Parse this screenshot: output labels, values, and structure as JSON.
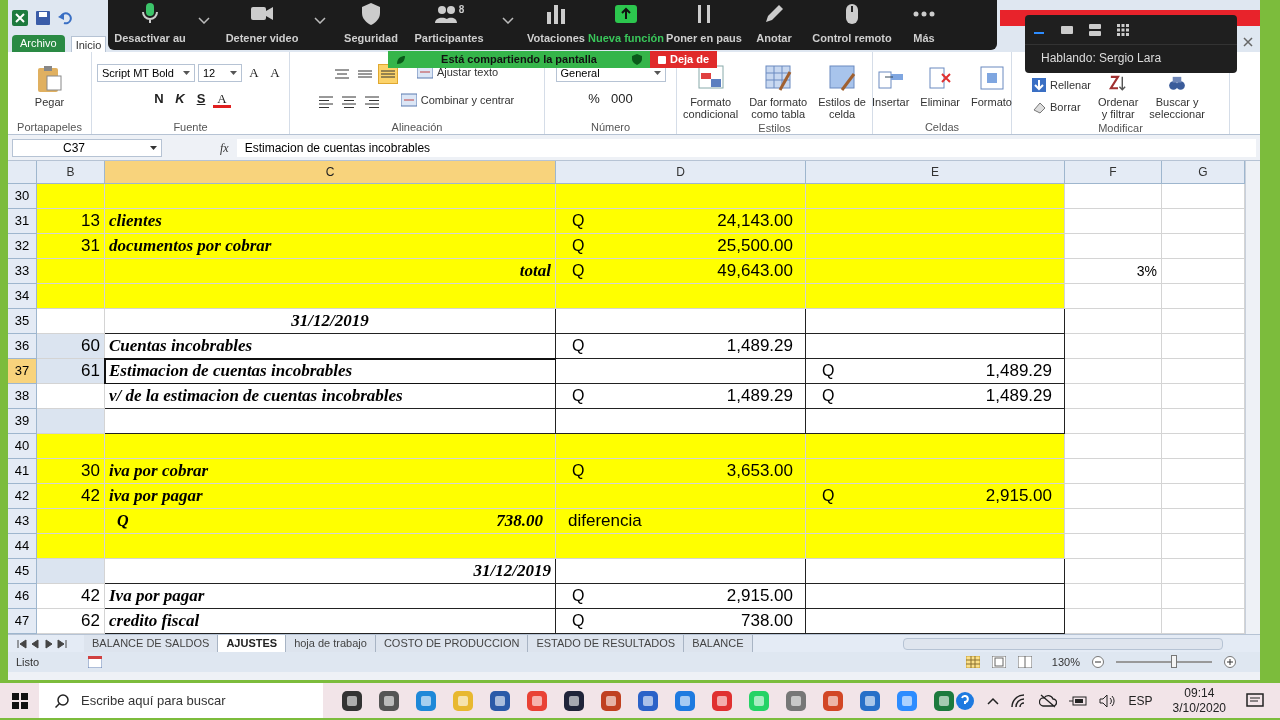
{
  "excel": {
    "ribbon_tabs": [
      {
        "label": "Archivo",
        "kind": "file",
        "selected": false
      },
      {
        "label": "Inicio",
        "kind": "tab",
        "selected": true
      }
    ],
    "ribbon_groups": [
      {
        "label": "Portapapeles",
        "rows": [
          [
            {
              "kind": "large",
              "lines": [
                "Pegar"
              ]
            }
          ]
        ]
      },
      {
        "label": "Fuente",
        "rows": [
          [
            {
              "kind": "field",
              "value": "Script MT Bold"
            },
            {
              "kind": "field",
              "value": "12"
            },
            {
              "kind": "glyph",
              "text": "A"
            },
            {
              "kind": "glyph",
              "text": "A"
            }
          ],
          [
            {
              "kind": "glyph",
              "text": "N"
            },
            {
              "kind": "glyph",
              "text": "K"
            },
            {
              "kind": "glyph",
              "text": "S"
            },
            {
              "kind": "glyph",
              "text": "A"
            }
          ]
        ]
      },
      {
        "label": "Alineación",
        "rows": [
          [
            {
              "kind": "align",
              "selected": false
            },
            {
              "kind": "align",
              "selected": false
            },
            {
              "kind": "align",
              "selected": true
            },
            {
              "kind": "small",
              "label": "Ajustar texto"
            }
          ],
          [
            {
              "kind": "align",
              "selected": false
            },
            {
              "kind": "align",
              "selected": false
            },
            {
              "kind": "align",
              "selected": false
            },
            {
              "kind": "small",
              "label": "Combinar y centrar"
            }
          ]
        ]
      },
      {
        "label": "Número",
        "rows": [
          [
            {
              "kind": "field",
              "value": "General"
            }
          ],
          [
            {
              "kind": "glyph",
              "text": "%"
            },
            {
              "kind": "glyph",
              "text": "000"
            }
          ]
        ]
      },
      {
        "label": "Estilos",
        "rows": [
          [
            {
              "kind": "large",
              "lines": [
                "Formato",
                "condicional"
              ]
            },
            {
              "kind": "large",
              "lines": [
                "Dar formato",
                "como tabla"
              ]
            },
            {
              "kind": "large",
              "lines": [
                "Estilos de",
                "celda"
              ]
            }
          ]
        ]
      },
      {
        "label": "Celdas",
        "rows": [
          [
            {
              "kind": "large",
              "lines": [
                "Insertar"
              ]
            },
            {
              "kind": "large",
              "lines": [
                "Eliminar"
              ]
            },
            {
              "kind": "large",
              "lines": [
                "Formato"
              ]
            }
          ]
        ]
      },
      {
        "label": "Modificar",
        "rows": [
          [
            {
              "kind": "stack",
              "items": [
                {
                  "label": "Rellenar"
                },
                {
                  "label": "Borrar"
                }
              ]
            },
            {
              "kind": "large",
              "lines": [
                "Ordenar",
                "y filtrar"
              ]
            },
            {
              "kind": "large",
              "lines": [
                "Buscar y",
                "seleccionar"
              ]
            }
          ]
        ]
      }
    ],
    "formula_bar": {
      "name_box": "C37",
      "fx": "fx",
      "value": "Estimacion de cuentas incobrables"
    },
    "columns": [
      {
        "label": "B",
        "selected": false
      },
      {
        "label": "C",
        "selected": true
      },
      {
        "label": "D",
        "selected": false
      },
      {
        "label": "E",
        "selected": false
      },
      {
        "label": "F",
        "selected": false
      },
      {
        "label": "G",
        "selected": false
      }
    ],
    "rows": [
      {
        "num": "30",
        "kind": "entry",
        "highlighted": true,
        "bordered": false,
        "b_shaded": false,
        "selected": false
      },
      {
        "num": "31",
        "kind": "entry",
        "highlighted": true,
        "bordered": false,
        "b_shaded": false,
        "selected": false,
        "b": "13",
        "c": "clientes",
        "d": {
          "currency": "Q",
          "amount": "24,143.00"
        }
      },
      {
        "num": "32",
        "kind": "entry",
        "highlighted": true,
        "bordered": false,
        "b_shaded": false,
        "selected": false,
        "b": "31",
        "c": "documentos por cobrar",
        "d": {
          "currency": "Q",
          "amount": "25,500.00"
        }
      },
      {
        "num": "33",
        "kind": "total",
        "highlighted": true,
        "bordered": false,
        "b_shaded": false,
        "selected": false,
        "c": "total",
        "d": {
          "currency": "Q",
          "amount": "49,643.00"
        },
        "f": "3%"
      },
      {
        "num": "34",
        "kind": "entry",
        "highlighted": true,
        "bordered": false,
        "b_shaded": false,
        "selected": false
      },
      {
        "num": "35",
        "kind": "heading",
        "highlighted": false,
        "bordered": true,
        "b_shaded": false,
        "selected": false,
        "c": "31/12/2019"
      },
      {
        "num": "36",
        "kind": "entry",
        "highlighted": false,
        "bordered": true,
        "b_shaded": true,
        "selected": false,
        "b": "60",
        "c": "Cuentas incobrables",
        "d": {
          "currency": "Q",
          "amount": "1,489.29"
        }
      },
      {
        "num": "37",
        "kind": "entry",
        "highlighted": false,
        "bordered": true,
        "b_shaded": true,
        "selected": true,
        "b": "61",
        "c": "Estimacion de cuentas incobrables",
        "e": {
          "currency": "Q",
          "amount": "1,489.29"
        }
      },
      {
        "num": "38",
        "kind": "entry",
        "highlighted": false,
        "bordered": true,
        "b_shaded": false,
        "selected": false,
        "c": "v/ de la estimacion de cuentas incobrables",
        "d": {
          "currency": "Q",
          "amount": "1,489.29"
        },
        "e": {
          "currency": "Q",
          "amount": "1,489.29"
        }
      },
      {
        "num": "39",
        "kind": "entry",
        "highlighted": false,
        "bordered": true,
        "b_shaded": true,
        "selected": false
      },
      {
        "num": "40",
        "kind": "entry",
        "highlighted": true,
        "bordered": false,
        "b_shaded": false,
        "selected": false
      },
      {
        "num": "41",
        "kind": "entry",
        "highlighted": true,
        "bordered": false,
        "b_shaded": false,
        "selected": false,
        "b": "30",
        "c": "iva por cobrar",
        "d": {
          "currency": "Q",
          "amount": "3,653.00"
        }
      },
      {
        "num": "42",
        "kind": "entry",
        "highlighted": true,
        "bordered": false,
        "b_shaded": false,
        "selected": false,
        "b": "42",
        "c": "iva por pagar",
        "e": {
          "currency": "Q",
          "amount": "2,915.00"
        }
      },
      {
        "num": "43",
        "kind": "entry",
        "highlighted": true,
        "bordered": false,
        "b_shaded": false,
        "selected": false,
        "c": {
          "currency": "Q",
          "amount": "738.00"
        },
        "d": "diferencia"
      },
      {
        "num": "44",
        "kind": "entry",
        "highlighted": true,
        "bordered": false,
        "b_shaded": false,
        "selected": false
      },
      {
        "num": "45",
        "kind": "total",
        "highlighted": false,
        "bordered": true,
        "b_shaded": true,
        "selected": false,
        "c": "31/12/2019"
      },
      {
        "num": "46",
        "kind": "entry",
        "highlighted": false,
        "bordered": true,
        "b_shaded": false,
        "selected": false,
        "b": "42",
        "c": "Iva por pagar",
        "d": {
          "currency": "Q",
          "amount": "2,915.00"
        }
      },
      {
        "num": "47",
        "kind": "entry",
        "highlighted": false,
        "bordered": true,
        "b_shaded": false,
        "selected": false,
        "b": "62",
        "c": "credito fiscal",
        "d": {
          "currency": "Q",
          "amount": "738.00"
        }
      }
    ],
    "sheet_tabs": [
      {
        "label": "BALANCE DE SALDOS",
        "selected": false
      },
      {
        "label": "AJUSTES",
        "selected": true
      },
      {
        "label": "hoja de trabajo",
        "selected": false
      },
      {
        "label": "COSTO DE PRODUCCION",
        "selected": false
      },
      {
        "label": "ESTADO DE RESULTADOS",
        "selected": false
      },
      {
        "label": "BALANCE",
        "selected": false
      }
    ],
    "status": {
      "text": "Listo",
      "zoom": "130%",
      "level": 0.6
    }
  },
  "zoom_toolbar": {
    "items": [
      {
        "label": "Desactivar au",
        "caret": true,
        "highlighted": false
      },
      {
        "label": "Detener video",
        "caret": true,
        "highlighted": false
      },
      {
        "label": "Seguridad",
        "caret": false,
        "highlighted": false
      },
      {
        "label": "Participantes",
        "count": "8",
        "caret": true,
        "highlighted": false
      },
      {
        "label": "Votaciones",
        "caret": false,
        "highlighted": false
      },
      {
        "label": "Nueva función",
        "caret": false,
        "highlighted": true
      },
      {
        "label": "Poner en paus",
        "caret": false,
        "highlighted": false
      },
      {
        "label": "Anotar",
        "caret": false,
        "highlighted": false
      },
      {
        "label": "Control remoto",
        "caret": false,
        "highlighted": false
      },
      {
        "label": "Más",
        "caret": false,
        "highlighted": false
      }
    ],
    "sharing": "Está compartiendo la pantalla",
    "stop": "Deja de"
  },
  "speaker_panel": {
    "text": "Hablando: Sergio Lara"
  },
  "taskbar": {
    "search_placeholder": "Escribe aquí para buscar",
    "language": "ESP",
    "time": "09:14",
    "date": "3/10/2020"
  }
}
